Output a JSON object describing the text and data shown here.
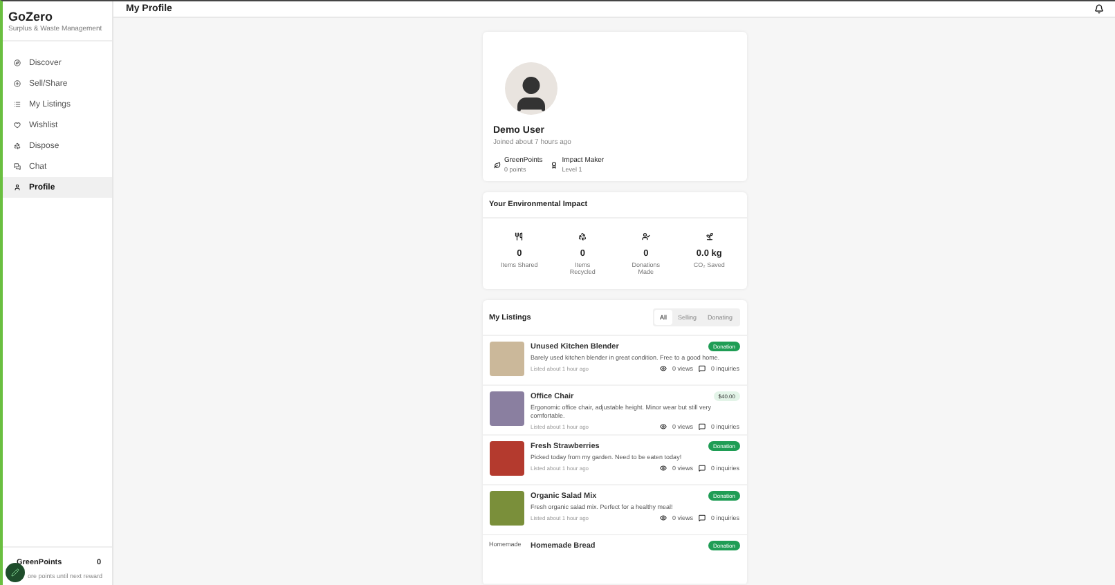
{
  "sidebar": {
    "brand": "GoZero",
    "tagline": "Surplus & Waste Management",
    "items": [
      {
        "label": "Discover",
        "selected": false
      },
      {
        "label": "Sell/Share",
        "selected": false
      },
      {
        "label": "My Listings",
        "selected": false
      },
      {
        "label": "Wishlist",
        "selected": false
      },
      {
        "label": "Dispose",
        "selected": false
      },
      {
        "label": "Chat",
        "selected": false
      },
      {
        "label": "Profile",
        "selected": true
      }
    ],
    "points": {
      "label": "GreenPoints",
      "value": "0",
      "note": "ore points until next reward"
    }
  },
  "header": {
    "title": "My Profile"
  },
  "profile": {
    "name": "Demo User",
    "joined": "Joined about 7 hours ago",
    "stats": [
      {
        "label": "GreenPoints",
        "value": "0 points"
      },
      {
        "label": "Impact Maker",
        "value": "Level 1"
      }
    ]
  },
  "impact": {
    "title": "Your Environmental Impact",
    "metrics": [
      {
        "value": "0",
        "label": "Items Shared"
      },
      {
        "value": "0",
        "label": "Items Recycled"
      },
      {
        "value": "0",
        "label": "Donations Made"
      },
      {
        "value": "0.0 kg",
        "label": "CO₂ Saved"
      }
    ]
  },
  "listings": {
    "title": "My Listings",
    "tabs": [
      {
        "label": "All",
        "selected": true
      },
      {
        "label": "Selling",
        "selected": false
      },
      {
        "label": "Donating",
        "selected": false
      }
    ],
    "items": [
      {
        "title": "Unused Kitchen Blender",
        "description": "Barely used kitchen blender in great condition. Free to a good home.",
        "listed": "Listed about 1 hour ago",
        "views": "0 views",
        "inquiries": "0 inquiries",
        "badge": {
          "kind": "donation",
          "text": "Donation"
        },
        "color": "#cbb89a"
      },
      {
        "title": "Office Chair",
        "description": "Ergonomic office chair, adjustable height. Minor wear but still very comfortable.",
        "listed": "Listed about 1 hour ago",
        "views": "0 views",
        "inquiries": "0 inquiries",
        "badge": {
          "kind": "price",
          "text": "$40.00"
        },
        "color": "#8a7fa0"
      },
      {
        "title": "Fresh Strawberries",
        "description": "Picked today from my garden. Need to be eaten today!",
        "listed": "Listed about 1 hour ago",
        "views": "0 views",
        "inquiries": "0 inquiries",
        "badge": {
          "kind": "donation",
          "text": "Donation"
        },
        "color": "#b43a2e"
      },
      {
        "title": "Organic Salad Mix",
        "description": "Fresh organic salad mix. Perfect for a healthy meal!",
        "listed": "Listed about 1 hour ago",
        "views": "0 views",
        "inquiries": "0 inquiries",
        "badge": {
          "kind": "donation",
          "text": "Donation"
        },
        "color": "#7a8f3a"
      },
      {
        "title": "Homemade Bread",
        "image_alt": "Homemade",
        "badge": {
          "kind": "donation",
          "text": "Donation"
        }
      }
    ]
  }
}
